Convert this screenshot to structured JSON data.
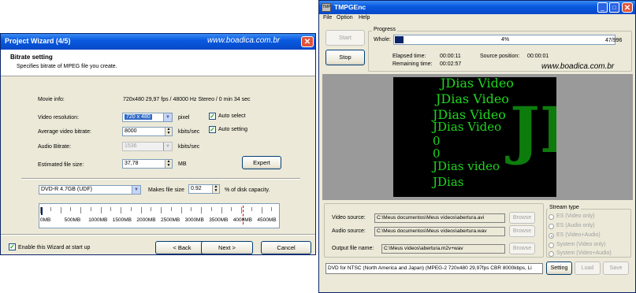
{
  "wizard": {
    "title": "Project Wizard (4/5)",
    "watermark": "www.boadica.com.br",
    "header_title": "Bitrate setting",
    "header_subtitle": "Specifies bitrate of MPEG file you create.",
    "movie_info_label": "Movie info:",
    "movie_info_value": "720x480 29,97 fps / 48000 Hz Stereo / 0 min 34 sec",
    "video_resolution_label": "Video resolution:",
    "video_resolution_value": "720 x 480",
    "video_resolution_unit": "pixel",
    "auto_select_label": "Auto select",
    "auto_select_checked": true,
    "avg_video_bitrate_label": "Average video bitrate:",
    "avg_video_bitrate_value": "8000",
    "avg_video_bitrate_unit": "kbits/sec",
    "auto_setting_label": "Auto setting",
    "auto_setting_checked": true,
    "audio_bitrate_label": "Audio Bitrate:",
    "audio_bitrate_value": "1536",
    "audio_bitrate_unit": "kbits/sec",
    "est_file_size_label": "Estimated file size:",
    "est_file_size_value": "37,78",
    "est_file_size_unit": "MB",
    "expert_button": "Expert",
    "media_value": "DVD-R 4.7GB (UDF)",
    "makes_file_size_label": "Makes file size",
    "makes_file_size_value": "0.92",
    "disk_capacity_label": "% of disk capacity.",
    "ruler_labels": [
      "0MB",
      "500MB",
      "1000MB",
      "1500MB",
      "2000MB",
      "2500MB",
      "3000MB",
      "3500MB",
      "4000MB",
      "4500MB"
    ],
    "ruler_fill_fraction": 0.0092,
    "enable_wizard_label": "Enable this Wizard at start up",
    "enable_wizard_checked": true,
    "back_button": "< Back",
    "next_button": "Next >",
    "cancel_button": "Cancel"
  },
  "tmpgenc": {
    "title": "TMPGEnc",
    "menu": [
      "File",
      "Option",
      "Help"
    ],
    "start_button": "Start",
    "stop_button": "Stop",
    "progress_title": "Progress",
    "whole_label": "Whole:",
    "progress_percent_text": "4%",
    "progress_fraction": 0.04,
    "frames_text": "47/996",
    "elapsed_label": "Elapsed time:",
    "elapsed_value": "00:00:11",
    "source_position_label": "Source position:",
    "source_position_value": "00:00:01",
    "remaining_label": "Remaining time:",
    "remaining_value": "00:02:57",
    "watermark": "www.boadica.com.br",
    "preview_lines": [
      "JDias Video",
      "JDias Video",
      "JDias Video",
      "JDias Video",
      "0",
      "0",
      "JDias video",
      "JDias"
    ],
    "video_source_label": "Video source:",
    "video_source_value": "C:\\Meus documentos\\Meus vídeos\\abertura.avi",
    "audio_source_label": "Audio source:",
    "audio_source_value": "C:\\Meus documentos\\Meus vídeos\\abertura.wav",
    "output_label": "Output file name:",
    "output_value": "C:\\Meus vídeos\\abertura.m2v+wav",
    "browse_button": "Browse",
    "stream_type_title": "Stream type",
    "stream_types": [
      "ES (Video only)",
      "ES (Audio only)",
      "ES (Video+Audio)",
      "System (Video only)",
      "System (Video+Audio)"
    ],
    "stream_type_selected": "ES (Video+Audio)",
    "status_text": "DVD for NTSC (North America and Japan) (MPEG-2 720x480 29,97fps CBR 8000kbps, Li",
    "setting_button": "Setting",
    "load_button": "Load",
    "save_button": "Save",
    "colors": {
      "matrix_text": "#1ed61e",
      "progress_fill": "#0a246a"
    }
  }
}
